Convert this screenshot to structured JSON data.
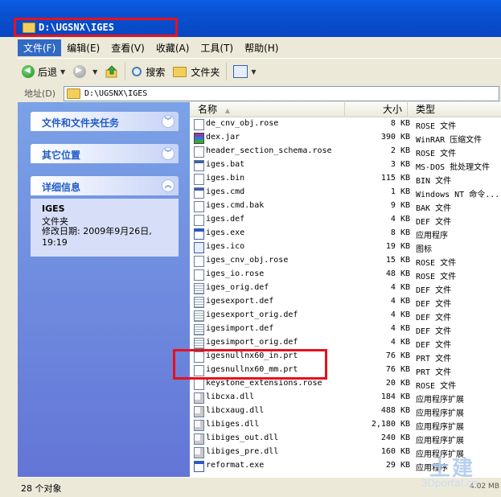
{
  "window": {
    "title": "D:\\UGSNX\\IGES"
  },
  "menu": {
    "items": [
      "文件(F)",
      "编辑(E)",
      "查看(V)",
      "收藏(A)",
      "工具(T)",
      "帮助(H)"
    ]
  },
  "toolbar": {
    "back_label": "后退",
    "search_label": "搜索",
    "folders_label": "文件夹"
  },
  "address": {
    "label": "地址(D)",
    "path": "D:\\UGSNX\\IGES"
  },
  "taskpane": {
    "file_tasks": "文件和文件夹任务",
    "other_places": "其它位置",
    "details": "详细信息",
    "detail_name": "IGES",
    "detail_type": "文件夹",
    "detail_modified": "修改日期: 2009年9月26日, 19:19"
  },
  "columns": {
    "name": "名称",
    "size": "大小",
    "type": "类型"
  },
  "files": [
    {
      "name": "de_cnv_obj.rose",
      "size": "8 KB",
      "type": "ROSE 文件",
      "icon": "generic-file-icon"
    },
    {
      "name": "dex.jar",
      "size": "390 KB",
      "type": "WinRAR 压缩文件",
      "icon": "winrar-icon"
    },
    {
      "name": "header_section_schema.rose",
      "size": "2 KB",
      "type": "ROSE 文件",
      "icon": "generic-file-icon"
    },
    {
      "name": "iges.bat",
      "size": "3 KB",
      "type": "MS-DOS 批处理文件",
      "icon": "batch-file-icon"
    },
    {
      "name": "iges.bin",
      "size": "115 KB",
      "type": "BIN 文件",
      "icon": "generic-file-icon"
    },
    {
      "name": "iges.cmd",
      "size": "1 KB",
      "type": "Windows NT 命令...",
      "icon": "batch-file-icon"
    },
    {
      "name": "iges.cmd.bak",
      "size": "9 KB",
      "type": "BAK 文件",
      "icon": "generic-file-icon"
    },
    {
      "name": "iges.def",
      "size": "4 KB",
      "type": "DEF 文件",
      "icon": "generic-file-icon"
    },
    {
      "name": "iges.exe",
      "size": "8 KB",
      "type": "应用程序",
      "icon": "exe-icon"
    },
    {
      "name": "iges.ico",
      "size": "19 KB",
      "type": "图标",
      "icon": "iges-icon"
    },
    {
      "name": "iges_cnv_obj.rose",
      "size": "15 KB",
      "type": "ROSE 文件",
      "icon": "generic-file-icon"
    },
    {
      "name": "iges_io.rose",
      "size": "48 KB",
      "type": "ROSE 文件",
      "icon": "generic-file-icon"
    },
    {
      "name": "iges_orig.def",
      "size": "4 KB",
      "type": "DEF 文件",
      "icon": "text-file-icon"
    },
    {
      "name": "igesexport.def",
      "size": "4 KB",
      "type": "DEF 文件",
      "icon": "text-file-icon"
    },
    {
      "name": "igesexport_orig.def",
      "size": "4 KB",
      "type": "DEF 文件",
      "icon": "text-file-icon"
    },
    {
      "name": "igesimport.def",
      "size": "4 KB",
      "type": "DEF 文件",
      "icon": "text-file-icon"
    },
    {
      "name": "igesimport_orig.def",
      "size": "4 KB",
      "type": "DEF 文件",
      "icon": "text-file-icon"
    },
    {
      "name": "igesnullnx60_in.prt",
      "size": "76 KB",
      "type": "PRT 文件",
      "icon": "generic-file-icon"
    },
    {
      "name": "igesnullnx60_mm.prt",
      "size": "76 KB",
      "type": "PRT 文件",
      "icon": "generic-file-icon"
    },
    {
      "name": "keystone_extensions.rose",
      "size": "20 KB",
      "type": "ROSE 文件",
      "icon": "generic-file-icon"
    },
    {
      "name": "libcxa.dll",
      "size": "184 KB",
      "type": "应用程序扩展",
      "icon": "dll-icon"
    },
    {
      "name": "libcxaug.dll",
      "size": "488 KB",
      "type": "应用程序扩展",
      "icon": "dll-icon"
    },
    {
      "name": "libiges.dll",
      "size": "2,180 KB",
      "type": "应用程序扩展",
      "icon": "dll-icon"
    },
    {
      "name": "libiges_out.dll",
      "size": "240 KB",
      "type": "应用程序扩展",
      "icon": "dll-icon"
    },
    {
      "name": "libiges_pre.dll",
      "size": "160 KB",
      "type": "应用程序扩展",
      "icon": "dll-icon"
    },
    {
      "name": "reformat.exe",
      "size": "29 KB",
      "type": "应用程序",
      "icon": "exe-icon"
    }
  ],
  "status": {
    "count": "28 个对象",
    "size": "4.02 MB"
  },
  "watermark": {
    "cn": "土建",
    "en": "3Dportal.cn"
  },
  "colors": {
    "titlebar": "#0a5ee6",
    "taskpane": "#6b8ddb",
    "highlight": "#e8101c",
    "menu_active": "#316ac5"
  }
}
